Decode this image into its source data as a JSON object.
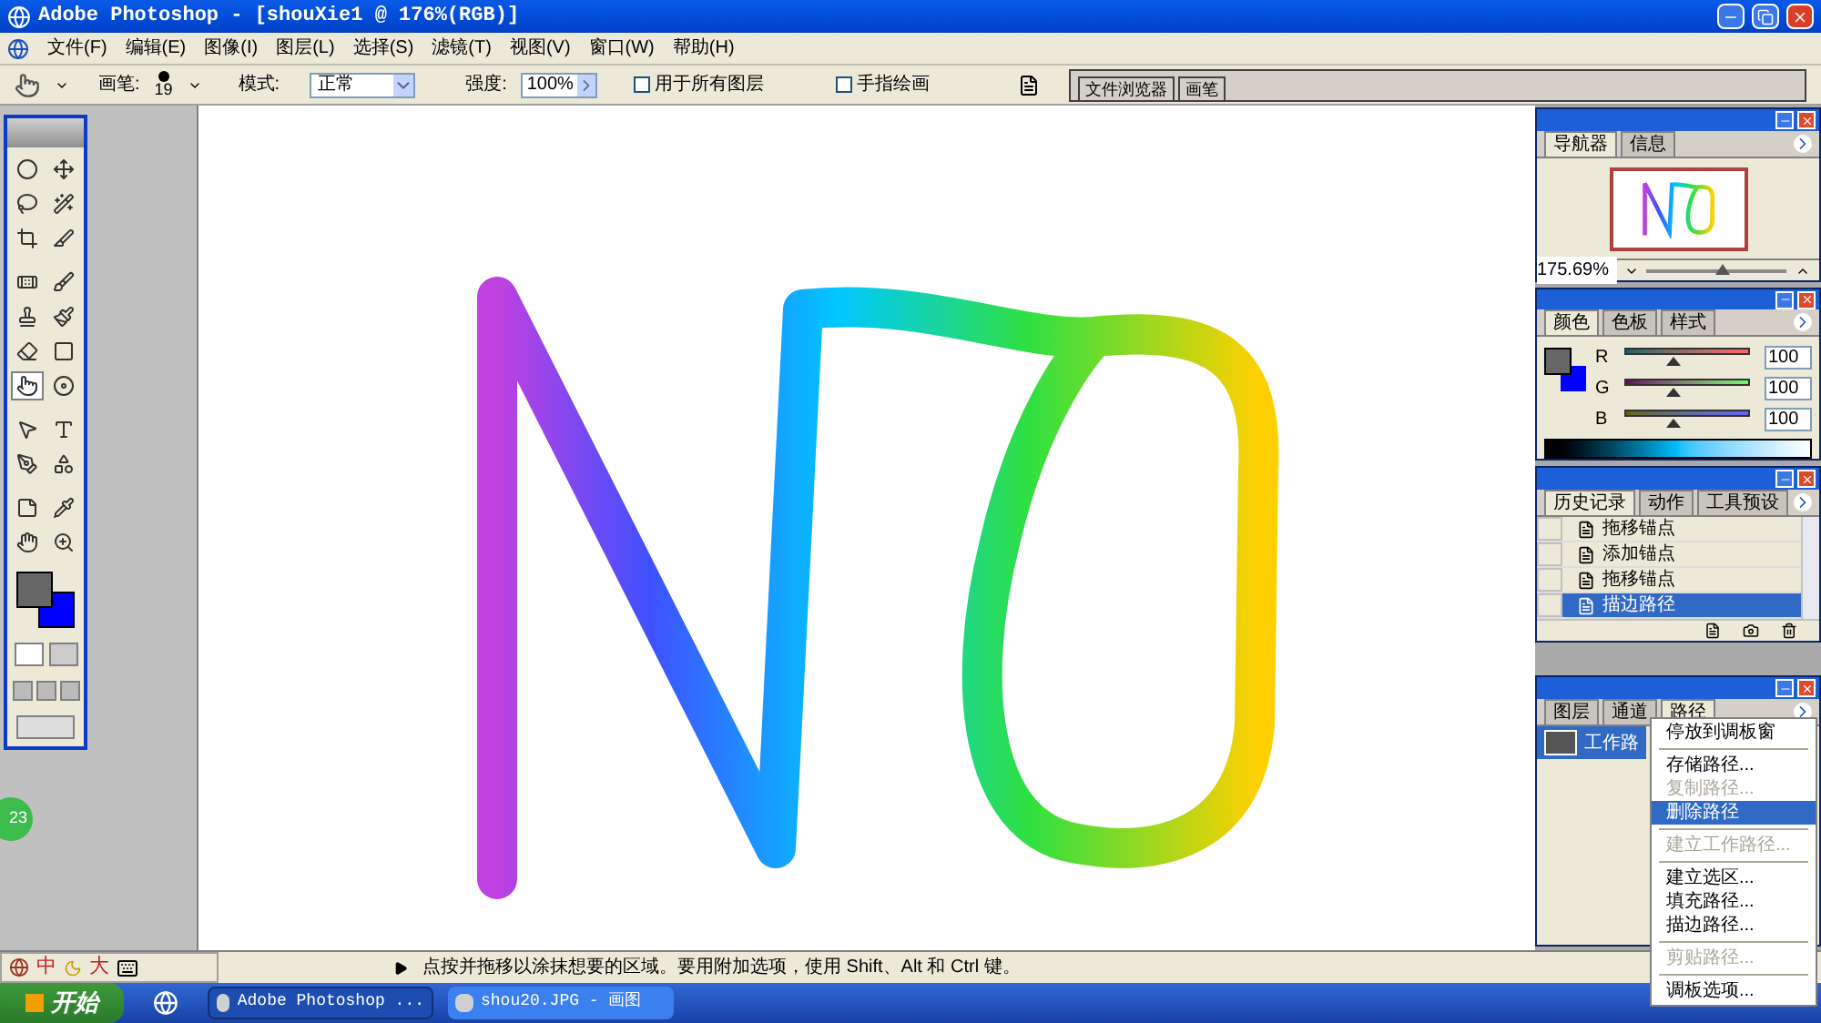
{
  "window": {
    "title": "Adobe Photoshop - [shouXie1 @ 176%(RGB)]"
  },
  "menu": [
    "文件(F)",
    "编辑(E)",
    "图像(I)",
    "图层(L)",
    "选择(S)",
    "滤镜(T)",
    "视图(V)",
    "窗口(W)",
    "帮助(H)"
  ],
  "options_bar": {
    "brush_label": "画笔:",
    "brush_size": "19",
    "mode_label": "模式:",
    "mode": "正常",
    "strength_label": "强度:",
    "strength": "100%",
    "checkboxes": [
      {
        "label": "用于所有图层",
        "checked": false
      },
      {
        "label": "手指绘画",
        "checked": false
      }
    ],
    "palette_well_tabs": [
      "文件浏览器",
      "画笔"
    ]
  },
  "toolbox": {
    "tools": [
      {
        "selected": false
      },
      {
        "selected": false
      },
      {
        "selected": false
      },
      {
        "selected": false
      },
      {
        "selected": false
      },
      {
        "selected": false
      },
      {
        "selected": false
      },
      {
        "selected": false
      },
      {
        "selected": false
      },
      {
        "selected": false
      },
      {
        "selected": false
      },
      {
        "selected": false
      },
      {
        "selected": true
      },
      {
        "selected": false
      },
      {
        "selected": false
      },
      {
        "selected": false
      },
      {
        "selected": false
      },
      {
        "selected": false
      },
      {
        "selected": false
      },
      {
        "selected": false
      },
      {
        "selected": false
      },
      {
        "selected": false
      }
    ]
  },
  "badge": "23",
  "navigator": {
    "tabs": [
      {
        "label": "导航器",
        "selected": true
      },
      {
        "label": "信息",
        "selected": false
      }
    ],
    "zoom": "175.69%",
    "level": 0.55
  },
  "color": {
    "tabs": [
      {
        "label": "颜色",
        "selected": true
      },
      {
        "label": "色板",
        "selected": false
      },
      {
        "label": "样式",
        "selected": false
      }
    ],
    "channels": [
      {
        "name": "R",
        "level": 0.39,
        "value": "100"
      },
      {
        "name": "G",
        "level": 0.39,
        "value": "100"
      },
      {
        "name": "B",
        "level": 0.39,
        "value": "100"
      }
    ]
  },
  "history": {
    "tabs": [
      {
        "label": "历史记录",
        "selected": true
      },
      {
        "label": "动作",
        "selected": false
      },
      {
        "label": "工具预设",
        "selected": false
      }
    ],
    "items": [
      {
        "label": "拖移锚点",
        "selected": false
      },
      {
        "label": "添加锚点",
        "selected": false
      },
      {
        "label": "拖移锚点",
        "selected": false
      },
      {
        "label": "描边路径",
        "selected": true
      }
    ]
  },
  "paths": {
    "tabs": [
      {
        "label": "图层",
        "selected": false
      },
      {
        "label": "通道",
        "selected": false
      },
      {
        "label": "路径",
        "selected": true
      }
    ],
    "rows": [
      {
        "label": "工作路",
        "selected": true
      }
    ]
  },
  "context_menu": {
    "groups": [
      [
        {
          "label": "停放到调板窗",
          "disabled": false,
          "selected": false
        }
      ],
      [
        {
          "label": "存储路径...",
          "disabled": false,
          "selected": false
        },
        {
          "label": "复制路径...",
          "disabled": true,
          "selected": false
        },
        {
          "label": "删除路径",
          "disabled": false,
          "selected": true
        }
      ],
      [
        {
          "label": "建立工作路径...",
          "disabled": true,
          "selected": false
        }
      ],
      [
        {
          "label": "建立选区...",
          "disabled": false,
          "selected": false
        },
        {
          "label": "填充路径...",
          "disabled": false,
          "selected": false
        },
        {
          "label": "描边路径...",
          "disabled": false,
          "selected": false
        }
      ],
      [
        {
          "label": "剪贴路径...",
          "disabled": true,
          "selected": false
        }
      ],
      [
        {
          "label": "调板选项...",
          "disabled": false,
          "selected": false
        }
      ]
    ]
  },
  "status_bar": {
    "ime": [
      "中",
      "大"
    ],
    "hint": "点按并拖移以涂抹想要的区域。要用附加选项，使用 Shift、Alt 和 Ctrl 键。"
  },
  "taskbar": {
    "start": "开始",
    "items": [
      {
        "label": "Adobe Photoshop ...",
        "selected": true
      },
      {
        "label": "shou20.JPG - 画图",
        "selected": false
      }
    ]
  }
}
